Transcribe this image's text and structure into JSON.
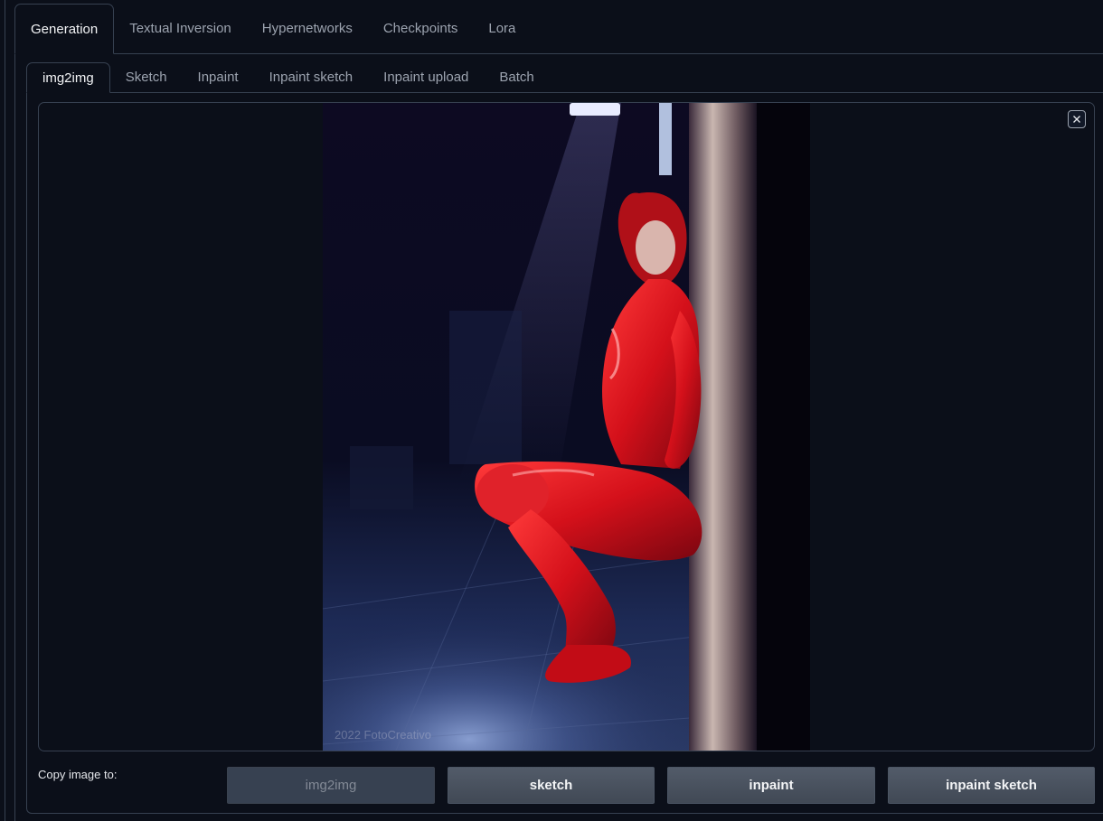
{
  "top_tabs": [
    {
      "label": "Generation",
      "active": true
    },
    {
      "label": "Textual Inversion",
      "active": false
    },
    {
      "label": "Hypernetworks",
      "active": false
    },
    {
      "label": "Checkpoints",
      "active": false
    },
    {
      "label": "Lora",
      "active": false
    }
  ],
  "sub_tabs": [
    {
      "label": "img2img",
      "active": true
    },
    {
      "label": "Sketch",
      "active": false
    },
    {
      "label": "Inpaint",
      "active": false
    },
    {
      "label": "Inpaint sketch",
      "active": false
    },
    {
      "label": "Inpaint upload",
      "active": false
    },
    {
      "label": "Batch",
      "active": false
    }
  ],
  "image": {
    "watermark": "2022 FotoCreativo",
    "clear_icon": "close-icon"
  },
  "copy": {
    "label": "Copy image to:",
    "buttons": [
      {
        "label": "img2img",
        "disabled": true
      },
      {
        "label": "sketch",
        "disabled": false
      },
      {
        "label": "inpaint",
        "disabled": false
      },
      {
        "label": "inpaint sketch",
        "disabled": false
      }
    ]
  },
  "colors": {
    "background": "#0b0f19",
    "border": "#374151",
    "button": "#4b5563",
    "subject_red": "#d4101a"
  }
}
